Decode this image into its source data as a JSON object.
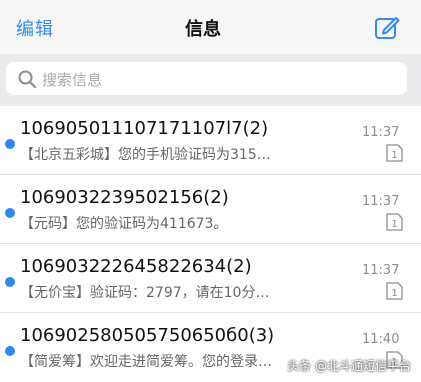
{
  "header": {
    "edit_label": "编辑",
    "title": "信息",
    "compose_icon": "compose-icon"
  },
  "search": {
    "placeholder": "搜索信息",
    "icon": "search-icon"
  },
  "messages": [
    {
      "sender": "106905011107171107l7(2)",
      "preview": "【北京五彩城】您的手机验证码为315…",
      "time": "11:37",
      "sim": "1"
    },
    {
      "sender": "1069032239502156(2)",
      "preview": "【元码】您的验证码为411673。",
      "time": "11:37",
      "sim": "1"
    },
    {
      "sender": "106903222645822634(2)",
      "preview": "【无价宝】验证码：2797，请在10分…",
      "time": "11:37",
      "sim": "1"
    },
    {
      "sender": "106902580505750650б0(3)",
      "preview": "【简爱筹】欢迎走进简爱筹。您的登录…",
      "time": "11:40",
      "sim": "1"
    }
  ],
  "watermark": "头条 @北斗通短信平台",
  "colors": {
    "accent": "#2f8df3",
    "unread_dot": "#2b89f0",
    "header_bg": "#f7f7f8",
    "search_bg": "#ebebed"
  }
}
